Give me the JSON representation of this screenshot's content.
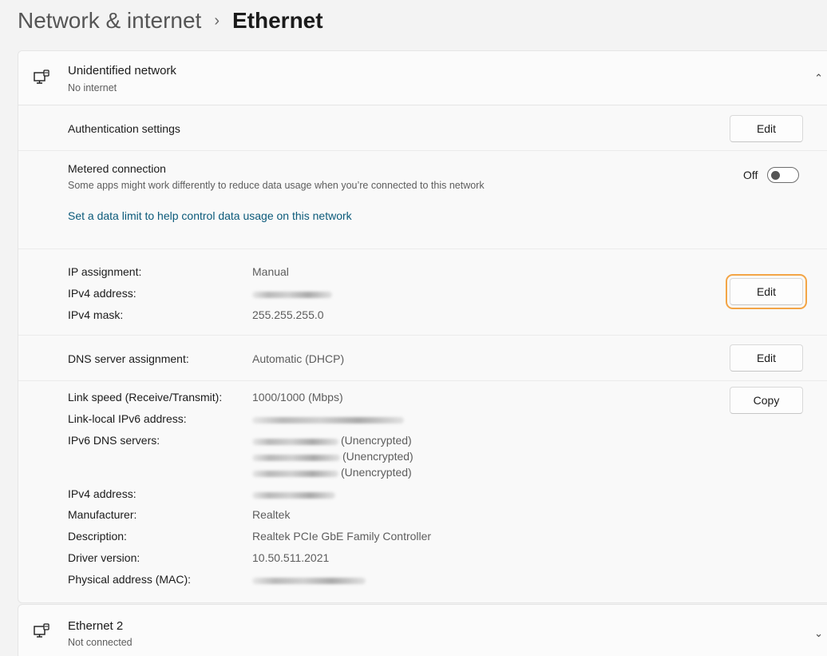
{
  "breadcrumb": {
    "parent": "Network & internet",
    "separator": "›",
    "current": "Ethernet"
  },
  "network1": {
    "icon": "ethernet-monitor-icon",
    "name": "Unidentified network",
    "status": "No internet",
    "chevron": "^",
    "authentication": {
      "label": "Authentication settings",
      "button": "Edit"
    },
    "metered": {
      "title": "Metered connection",
      "description": "Some apps might work differently to reduce data usage when you’re connected to this network",
      "toggle_label": "Off",
      "toggle_on": false,
      "link": "Set a data limit to help control data usage on this network"
    },
    "ip": {
      "assignment_label": "IP assignment:",
      "assignment_value": "Manual",
      "ipv4_label": "IPv4 address:",
      "mask_label": "IPv4 mask:",
      "mask_value": "255.255.255.0",
      "button": "Edit"
    },
    "dns": {
      "label": "DNS server assignment:",
      "value": "Automatic (DHCP)",
      "button": "Edit"
    },
    "properties": {
      "link_speed_label": "Link speed (Receive/Transmit):",
      "link_speed_value": "1000/1000 (Mbps)",
      "ipv6_local_label": "Link-local IPv6 address:",
      "ipv6_dns_label": "IPv6 DNS servers:",
      "dns_suffix": "(Unencrypted)",
      "ipv4_label": "IPv4 address:",
      "manufacturer_label": "Manufacturer:",
      "manufacturer_value": "Realtek",
      "description_label": "Description:",
      "description_value": "Realtek PCIe GbE Family Controller",
      "driver_label": "Driver version:",
      "driver_value": "10.50.511.2021",
      "mac_label": "Physical address (MAC):",
      "button": "Copy"
    }
  },
  "network2": {
    "icon": "ethernet-monitor-icon",
    "name": "Ethernet 2",
    "status": "Not connected",
    "chevron": "v"
  },
  "colors": {
    "accent_link": "#0b5a7a",
    "highlight": "#f3a546",
    "background": "#f3f3f3"
  }
}
